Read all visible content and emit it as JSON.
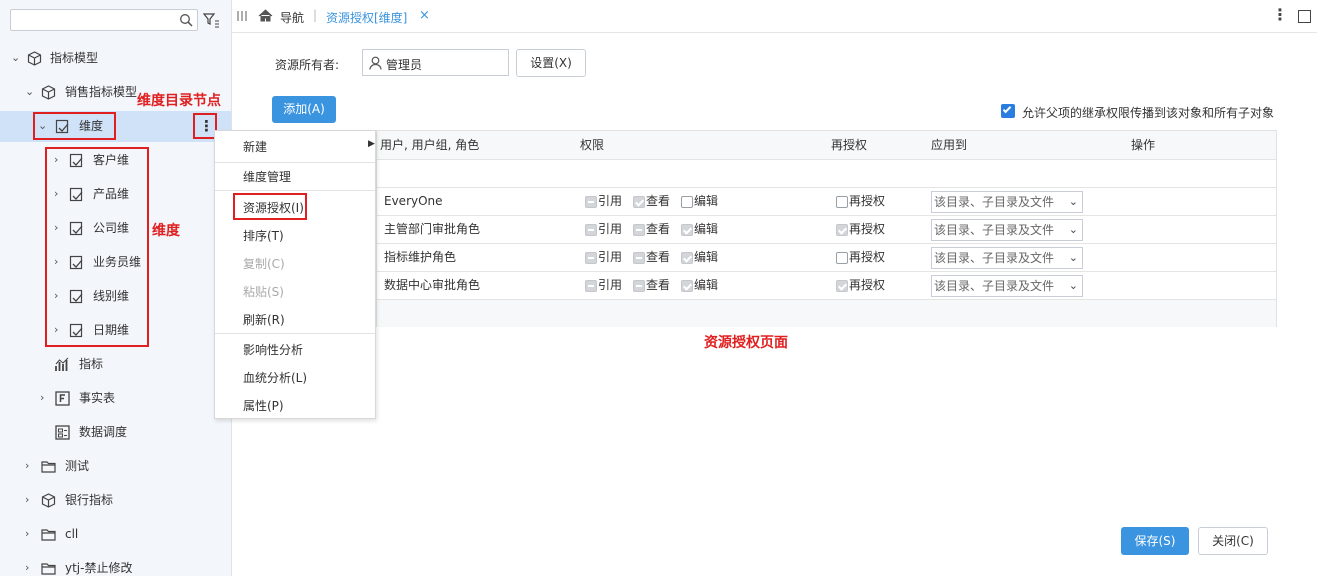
{
  "sidebar": {
    "search_placeholder": "",
    "tree": [
      {
        "label": "指标模型"
      },
      {
        "label": "销售指标模型"
      },
      {
        "label": "维度"
      },
      {
        "label": "客户维"
      },
      {
        "label": "产品维"
      },
      {
        "label": "公司维"
      },
      {
        "label": "业务员维"
      },
      {
        "label": "线别维"
      },
      {
        "label": "日期维"
      },
      {
        "label": "指标"
      },
      {
        "label": "事实表"
      },
      {
        "label": "数据调度"
      },
      {
        "label": "测试"
      },
      {
        "label": "银行指标"
      },
      {
        "label": "cll"
      },
      {
        "label": "ytj-禁止修改"
      }
    ],
    "more_button": "⋮"
  },
  "annotations": {
    "dim_dir_node": "维度目录节点",
    "dimension": "维度",
    "resource_auth_page": "资源授权页面"
  },
  "context_menu": {
    "items": [
      "新建",
      "维度管理",
      "资源授权(I)",
      "排序(T)",
      "复制(C)",
      "粘贴(S)",
      "刷新(R)",
      "影响性分析",
      "血统分析(L)",
      "属性(P)"
    ]
  },
  "topbar": {
    "nav_label": "导航",
    "separator": "|",
    "tab_label": "资源授权[维度]",
    "close": "×"
  },
  "form": {
    "owner_label": "资源所有者:",
    "owner_value": "管理员",
    "set_button": "设置(X)",
    "add_button": "添加(A)",
    "inherit_label": "允许父项的继承权限传播到该对象和所有子对象",
    "inherit_checked": true
  },
  "table": {
    "headers": [
      "用户, 用户组, 角色",
      "权限",
      "再授权",
      "应用到",
      "操作"
    ],
    "rows": [
      {
        "name": "EveryOne",
        "ref": "引用",
        "view": "查看",
        "edit": "编辑",
        "regrant": "再授权",
        "apply": "该目录、子目录及文件",
        "ref_state": "ind",
        "view_state": "chkd",
        "edit_state": "empty",
        "regrant_state": "empty"
      },
      {
        "name": "主管部门审批角色",
        "ref": "引用",
        "view": "查看",
        "edit": "编辑",
        "regrant": "再授权",
        "apply": "该目录、子目录及文件",
        "ref_state": "ind",
        "view_state": "ind",
        "edit_state": "chkd",
        "regrant_state": "chkd"
      },
      {
        "name": "指标维护角色",
        "ref": "引用",
        "view": "查看",
        "edit": "编辑",
        "regrant": "再授权",
        "apply": "该目录、子目录及文件",
        "ref_state": "ind",
        "view_state": "ind",
        "edit_state": "chkd",
        "regrant_state": "empty"
      },
      {
        "name": "数据中心审批角色",
        "ref": "引用",
        "view": "查看",
        "edit": "编辑",
        "regrant": "再授权",
        "apply": "该目录、子目录及文件",
        "ref_state": "ind",
        "view_state": "ind",
        "edit_state": "chkd",
        "regrant_state": "chkd"
      }
    ]
  },
  "footer": {
    "save_button": "保存(S)",
    "close_button": "关闭(C)"
  },
  "colors": {
    "accent": "#3b94e0",
    "annotation_red": "#e02020",
    "selected_row": "#cfe2f8"
  }
}
